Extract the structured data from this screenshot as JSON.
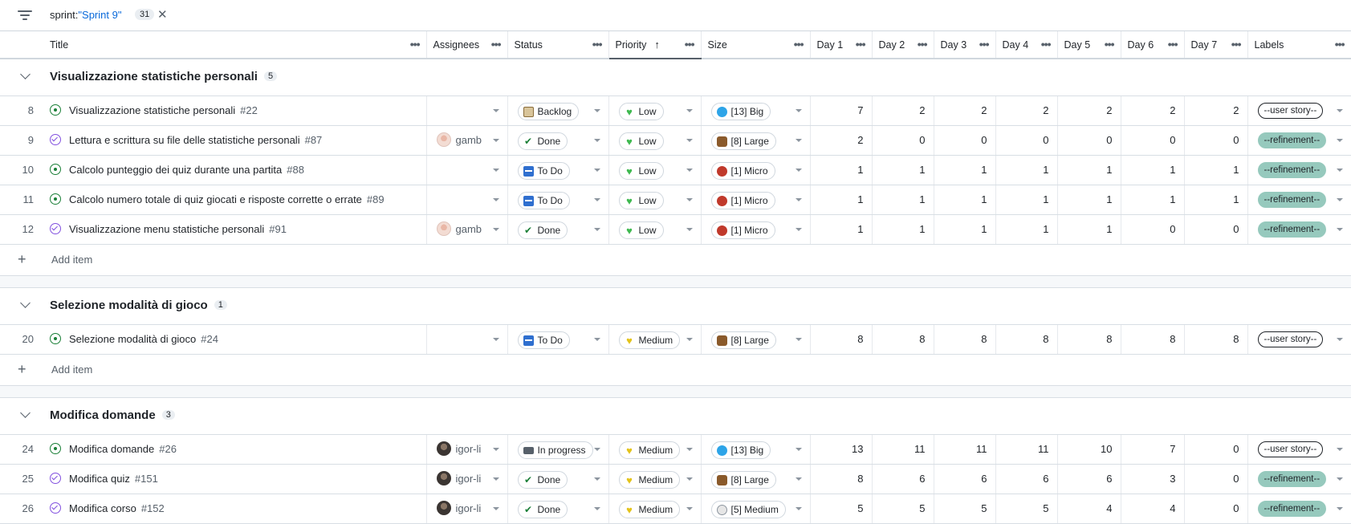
{
  "filter": {
    "key": "sprint:",
    "value": "\"Sprint 9\"",
    "count": "31"
  },
  "columns": {
    "title": "Title",
    "assignees": "Assignees",
    "status": "Status",
    "priority": "Priority",
    "size": "Size",
    "day1": "Day 1",
    "day2": "Day 2",
    "day3": "Day 3",
    "day4": "Day 4",
    "day5": "Day 5",
    "day6": "Day 6",
    "day7": "Day 7",
    "labels": "Labels"
  },
  "add_item_label": "Add item",
  "groups": [
    {
      "title": "Visualizzazione statistiche personali",
      "count": "5",
      "rows": [
        {
          "n": "8",
          "state": "open",
          "title": "Visualizzazione statistiche personali",
          "num": "#22",
          "assignee": "",
          "status": "Backlog",
          "priority": "Low",
          "size": "[13] Big",
          "days": [
            "7",
            "2",
            "2",
            "2",
            "2",
            "2",
            "2"
          ],
          "label": "--user story--"
        },
        {
          "n": "9",
          "state": "done",
          "title": "Lettura e scrittura su file delle statistiche personali",
          "num": "#87",
          "assignee": "gamb",
          "status": "Done",
          "priority": "Low",
          "size": "[8] Large",
          "days": [
            "2",
            "0",
            "0",
            "0",
            "0",
            "0",
            "0"
          ],
          "label": "--refinement--"
        },
        {
          "n": "10",
          "state": "open",
          "title": "Calcolo punteggio dei quiz durante una partita",
          "num": "#88",
          "assignee": "",
          "status": "To Do",
          "priority": "Low",
          "size": "[1] Micro",
          "days": [
            "1",
            "1",
            "1",
            "1",
            "1",
            "1",
            "1"
          ],
          "label": "--refinement--"
        },
        {
          "n": "11",
          "state": "open",
          "title": "Calcolo numero totale di quiz giocati e risposte corrette o errate",
          "num": "#89",
          "assignee": "",
          "status": "To Do",
          "priority": "Low",
          "size": "[1] Micro",
          "days": [
            "1",
            "1",
            "1",
            "1",
            "1",
            "1",
            "1"
          ],
          "label": "--refinement--"
        },
        {
          "n": "12",
          "state": "done",
          "title": "Visualizzazione menu statistiche personali",
          "num": "#91",
          "assignee": "gamb",
          "status": "Done",
          "priority": "Low",
          "size": "[1] Micro",
          "days": [
            "1",
            "1",
            "1",
            "1",
            "1",
            "0",
            "0"
          ],
          "label": "--refinement--"
        }
      ]
    },
    {
      "title": "Selezione modalità di gioco",
      "count": "1",
      "rows": [
        {
          "n": "20",
          "state": "open",
          "title": "Selezione modalità di gioco",
          "num": "#24",
          "assignee": "",
          "status": "To Do",
          "priority": "Medium",
          "size": "[8] Large",
          "days": [
            "8",
            "8",
            "8",
            "8",
            "8",
            "8",
            "8"
          ],
          "label": "--user story--"
        }
      ]
    },
    {
      "title": "Modifica domande",
      "count": "3",
      "rows": [
        {
          "n": "24",
          "state": "open",
          "title": "Modifica domande",
          "num": "#26",
          "assignee": "igor-li",
          "status": "In progress",
          "priority": "Medium",
          "size": "[13] Big",
          "days": [
            "13",
            "11",
            "11",
            "11",
            "10",
            "7",
            "0"
          ],
          "label": "--user story--"
        },
        {
          "n": "25",
          "state": "done",
          "title": "Modifica quiz",
          "num": "#151",
          "assignee": "igor-li",
          "status": "Done",
          "priority": "Medium",
          "size": "[8] Large",
          "days": [
            "8",
            "6",
            "6",
            "6",
            "6",
            "3",
            "0"
          ],
          "label": "--refinement--"
        },
        {
          "n": "26",
          "state": "done",
          "title": "Modifica corso",
          "num": "#152",
          "assignee": "igor-li",
          "status": "Done",
          "priority": "Medium",
          "size": "[5] Medium",
          "days": [
            "5",
            "5",
            "5",
            "5",
            "4",
            "4",
            "0"
          ],
          "label": "--refinement--"
        }
      ]
    }
  ]
}
